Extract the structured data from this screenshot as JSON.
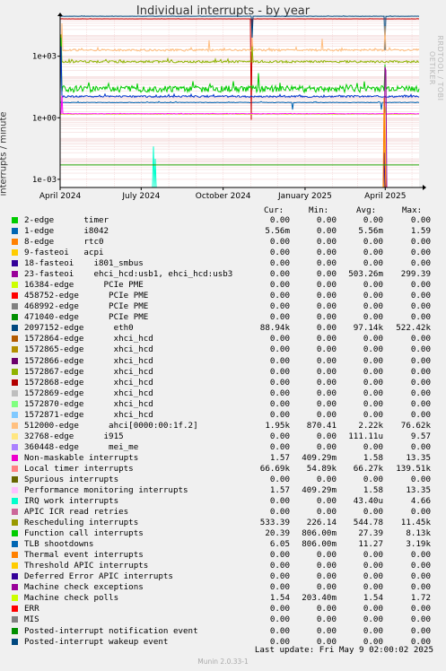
{
  "title": "Individual interrupts - by year",
  "vertical_label": "interrupts / minute",
  "watermark": "RRDTOOL / TOBI OETIKER",
  "last_update": "Last update:  Fri May  9 02:00:02 2025",
  "munin_version": "Munin 2.0.33-1",
  "columns": [
    "Cur:",
    "Min:",
    "Avg:",
    "Max:"
  ],
  "chart_data": {
    "type": "line",
    "title": "Individual interrupts - by year",
    "ylabel": "interrupts / minute",
    "yscale": "log",
    "ylim": [
      0.0004,
      60000
    ],
    "y_ticks": [
      "1e-03",
      "1e+00",
      "1e+03"
    ],
    "xlim": [
      "2024-04-01",
      "2025-05-09"
    ],
    "x_ticks": [
      {
        "label": "April 2024",
        "date": "2024-04-01"
      },
      {
        "label": "July 2024",
        "date": "2024-07-01"
      },
      {
        "label": "October 2024",
        "date": "2024-10-01"
      },
      {
        "label": "January 2025",
        "date": "2025-01-01"
      },
      {
        "label": "April 2025",
        "date": "2025-04-01"
      }
    ],
    "grid": true,
    "series": [
      {
        "name": "1-edge i8042",
        "color": "#0066B3",
        "level": 5.56,
        "noise": 0.03,
        "start": "2024-04-01",
        "spikes": [
          [
            "2024-12-18",
            2.5
          ],
          [
            "2025-03-28",
            2.5
          ]
        ]
      },
      {
        "name": "Local timer interrupts",
        "color": "#CC0000",
        "level": 66000,
        "noise": 0.01,
        "start": "2024-04-01",
        "spikes": [
          [
            "2024-11-02",
            0.8
          ]
        ]
      },
      {
        "name": "2097152-edge eth0",
        "color": "#00487F",
        "level": 88940,
        "noise": 0.015,
        "start": "2024-04-01",
        "spikes": [
          [
            "2024-11-03",
            8000
          ],
          [
            "2025-04-01",
            2000
          ]
        ]
      },
      {
        "name": "512000-edge ahci[0000:00:1f.2]",
        "color": "#FFBE7F",
        "level": 2000,
        "noise": 0.12,
        "start": "2024-04-01",
        "spikes": [
          [
            "2024-04-03",
            40000
          ],
          [
            "2024-09-15",
            6000
          ],
          [
            "2024-11-03",
            8000
          ],
          [
            "2025-01-20",
            7000
          ],
          [
            "2025-04-01",
            30000
          ]
        ]
      },
      {
        "name": "Rescheduling interrupts",
        "color": "#8EB200",
        "level": 545,
        "noise": 0.12,
        "start": "2024-04-01",
        "spikes": [
          [
            "2024-04-02",
            11450
          ],
          [
            "2024-11-03",
            3000
          ]
        ]
      },
      {
        "name": "Function call interrupts",
        "color": "#00CC00",
        "level": 27,
        "noise": 0.35,
        "start": "2024-04-01",
        "spikes": [
          [
            "2024-04-02",
            8000
          ],
          [
            "2024-11-10",
            150
          ],
          [
            "2025-04-01",
            400
          ]
        ]
      },
      {
        "name": "TLB shootdowns",
        "color": "#0033CC",
        "level": 11,
        "noise": 0.1,
        "start": "2024-04-01",
        "spikes": [
          [
            "2024-04-02",
            3000
          ]
        ]
      },
      {
        "name": "9-fasteoi acpi",
        "color": "#CCFF00",
        "level": 1.5,
        "noise": 0.02,
        "start": "2024-04-01",
        "spikes": [
          [
            "2025-04-01",
            3.5
          ]
        ]
      },
      {
        "name": "Non-maskable interrupts",
        "color": "#FF00FF",
        "level": 1.57,
        "noise": 0.02,
        "start": "2024-04-01",
        "spikes": [
          [
            "2024-04-03",
            12
          ]
        ]
      },
      {
        "name": "IRQ work interrupts",
        "color": "#00FFCC",
        "level": 0.0004,
        "noise": 0,
        "start": "2024-04-01",
        "spikes": [
          [
            "2024-07-15",
            0.04
          ],
          [
            "2024-07-17",
            0.01
          ]
        ]
      },
      {
        "name": "23-fasteoi ehci_hcd:usb1, ehci_hcd:usb3",
        "color": "#990099",
        "level": 0.0004,
        "noise": 0,
        "start": "2024-04-01",
        "spikes": [
          [
            "2025-04-01",
            299.39
          ],
          [
            "2025-04-02",
            200
          ]
        ]
      },
      {
        "name": "Machine check polls",
        "color": "#FFCC33",
        "level": 0.0004,
        "noise": 0,
        "start": "2024-04-01",
        "spikes": [
          [
            "2025-04-01",
            1.72
          ]
        ]
      },
      {
        "name": "Deferred Error APIC interrupts",
        "color": "#330099",
        "level": 0.0004,
        "noise": 0,
        "start": "2024-04-01",
        "spikes": [
          [
            "2025-03-31",
            0.02
          ]
        ]
      },
      {
        "name": "32768-edge i915",
        "color": "#FF7F00",
        "level": 0.0004,
        "noise": 0,
        "start": "2024-04-01",
        "spikes": [
          [
            "2025-03-31",
            9.57
          ],
          [
            "2025-04-01",
            0.01
          ]
        ]
      },
      {
        "name": "471040-edge PCIe PME",
        "color": "#22A000",
        "level": 0.005,
        "noise": 0,
        "start": "2024-04-01",
        "spikes": []
      }
    ]
  },
  "legend": [
    {
      "name": "2-edge      timer",
      "color": "#00CC00",
      "cur": "0.00",
      "min": "0.00",
      "avg": "0.00",
      "max": "0.00"
    },
    {
      "name": "1-edge      i8042",
      "color": "#0066B3",
      "cur": "5.56m",
      "min": "0.00",
      "avg": "5.56m",
      "max": "1.59"
    },
    {
      "name": "8-edge      rtc0",
      "color": "#FF8000",
      "cur": "0.00",
      "min": "0.00",
      "avg": "0.00",
      "max": "0.00"
    },
    {
      "name": "9-fasteoi   acpi",
      "color": "#FFCC00",
      "cur": "0.00",
      "min": "0.00",
      "avg": "0.00",
      "max": "0.00"
    },
    {
      "name": "18-fasteoi    i801_smbus",
      "color": "#330099",
      "cur": "0.00",
      "min": "0.00",
      "avg": "0.00",
      "max": "0.00"
    },
    {
      "name": "23-fasteoi    ehci_hcd:usb1, ehci_hcd:usb3",
      "color": "#990099",
      "cur": "0.00",
      "min": "0.00",
      "avg": "503.26m",
      "max": "299.39"
    },
    {
      "name": "16384-edge      PCIe PME",
      "color": "#CCFF00",
      "cur": "0.00",
      "min": "0.00",
      "avg": "0.00",
      "max": "0.00"
    },
    {
      "name": "458752-edge      PCIe PME",
      "color": "#FF0000",
      "cur": "0.00",
      "min": "0.00",
      "avg": "0.00",
      "max": "0.00"
    },
    {
      "name": "468992-edge      PCIe PME",
      "color": "#808080",
      "cur": "0.00",
      "min": "0.00",
      "avg": "0.00",
      "max": "0.00"
    },
    {
      "name": "471040-edge      PCIe PME",
      "color": "#008F00",
      "cur": "0.00",
      "min": "0.00",
      "avg": "0.00",
      "max": "0.00"
    },
    {
      "name": "2097152-edge      eth0",
      "color": "#00487F",
      "cur": "88.94k",
      "min": "0.00",
      "avg": "97.14k",
      "max": "522.42k"
    },
    {
      "name": "1572864-edge      xhci_hcd",
      "color": "#B35A00",
      "cur": "0.00",
      "min": "0.00",
      "avg": "0.00",
      "max": "0.00"
    },
    {
      "name": "1572865-edge      xhci_hcd",
      "color": "#B38F00",
      "cur": "0.00",
      "min": "0.00",
      "avg": "0.00",
      "max": "0.00"
    },
    {
      "name": "1572866-edge      xhci_hcd",
      "color": "#6B006B",
      "cur": "0.00",
      "min": "0.00",
      "avg": "0.00",
      "max": "0.00"
    },
    {
      "name": "1572867-edge      xhci_hcd",
      "color": "#8FB300",
      "cur": "0.00",
      "min": "0.00",
      "avg": "0.00",
      "max": "0.00"
    },
    {
      "name": "1572868-edge      xhci_hcd",
      "color": "#B30000",
      "cur": "0.00",
      "min": "0.00",
      "avg": "0.00",
      "max": "0.00"
    },
    {
      "name": "1572869-edge      xhci_hcd",
      "color": "#BEBEBE",
      "cur": "0.00",
      "min": "0.00",
      "avg": "0.00",
      "max": "0.00"
    },
    {
      "name": "1572870-edge      xhci_hcd",
      "color": "#80FF80",
      "cur": "0.00",
      "min": "0.00",
      "avg": "0.00",
      "max": "0.00"
    },
    {
      "name": "1572871-edge      xhci_hcd",
      "color": "#80C9FF",
      "cur": "0.00",
      "min": "0.00",
      "avg": "0.00",
      "max": "0.00"
    },
    {
      "name": "512000-edge      ahci[0000:00:1f.2]",
      "color": "#FFC080",
      "cur": "1.95k",
      "min": "870.41",
      "avg": "2.22k",
      "max": "76.62k"
    },
    {
      "name": "32768-edge      i915",
      "color": "#FFE680",
      "cur": "0.00",
      "min": "0.00",
      "avg": "111.11u",
      "max": "9.57"
    },
    {
      "name": "360448-edge      mei_me",
      "color": "#AA80FF",
      "cur": "0.00",
      "min": "0.00",
      "avg": "0.00",
      "max": "0.00"
    },
    {
      "name": "Non-maskable interrupts",
      "color": "#EE00CC",
      "cur": "1.57",
      "min": "409.29m",
      "avg": "1.58",
      "max": "13.35"
    },
    {
      "name": "Local timer interrupts",
      "color": "#FF8080",
      "cur": "66.69k",
      "min": "54.89k",
      "avg": "66.27k",
      "max": "139.51k"
    },
    {
      "name": "Spurious interrupts",
      "color": "#666600",
      "cur": "0.00",
      "min": "0.00",
      "avg": "0.00",
      "max": "0.00"
    },
    {
      "name": "Performance monitoring interrupts",
      "color": "#FFBFFF",
      "cur": "1.57",
      "min": "409.29m",
      "avg": "1.58",
      "max": "13.35"
    },
    {
      "name": "IRQ work interrupts",
      "color": "#00FFCC",
      "cur": "0.00",
      "min": "0.00",
      "avg": "43.40u",
      "max": "4.66"
    },
    {
      "name": "APIC ICR read retries",
      "color": "#CC6699",
      "cur": "0.00",
      "min": "0.00",
      "avg": "0.00",
      "max": "0.00"
    },
    {
      "name": "Rescheduling interrupts",
      "color": "#999900",
      "cur": "533.39",
      "min": "226.14",
      "avg": "544.78",
      "max": "11.45k"
    },
    {
      "name": "Function call interrupts",
      "color": "#00CC00",
      "cur": "20.39",
      "min": "806.00m",
      "avg": "27.39",
      "max": "8.13k"
    },
    {
      "name": "TLB shootdowns",
      "color": "#0066B3",
      "cur": "6.05",
      "min": "806.00m",
      "avg": "11.27",
      "max": "3.19k"
    },
    {
      "name": "Thermal event interrupts",
      "color": "#FF8000",
      "cur": "0.00",
      "min": "0.00",
      "avg": "0.00",
      "max": "0.00"
    },
    {
      "name": "Threshold APIC interrupts",
      "color": "#FFCC00",
      "cur": "0.00",
      "min": "0.00",
      "avg": "0.00",
      "max": "0.00"
    },
    {
      "name": "Deferred Error APIC interrupts",
      "color": "#330099",
      "cur": "0.00",
      "min": "0.00",
      "avg": "0.00",
      "max": "0.00"
    },
    {
      "name": "Machine check exceptions",
      "color": "#990099",
      "cur": "0.00",
      "min": "0.00",
      "avg": "0.00",
      "max": "0.00"
    },
    {
      "name": "Machine check polls",
      "color": "#CCFF00",
      "cur": "1.54",
      "min": "203.40m",
      "avg": "1.54",
      "max": "1.72"
    },
    {
      "name": "ERR",
      "color": "#FF0000",
      "cur": "0.00",
      "min": "0.00",
      "avg": "0.00",
      "max": "0.00"
    },
    {
      "name": "MIS",
      "color": "#808080",
      "cur": "0.00",
      "min": "0.00",
      "avg": "0.00",
      "max": "0.00"
    },
    {
      "name": "Posted-interrupt notification event",
      "color": "#008F00",
      "cur": "0.00",
      "min": "0.00",
      "avg": "0.00",
      "max": "0.00"
    },
    {
      "name": "Posted-interrupt wakeup event",
      "color": "#00487F",
      "cur": "0.00",
      "min": "0.00",
      "avg": "0.00",
      "max": "0.00"
    }
  ]
}
